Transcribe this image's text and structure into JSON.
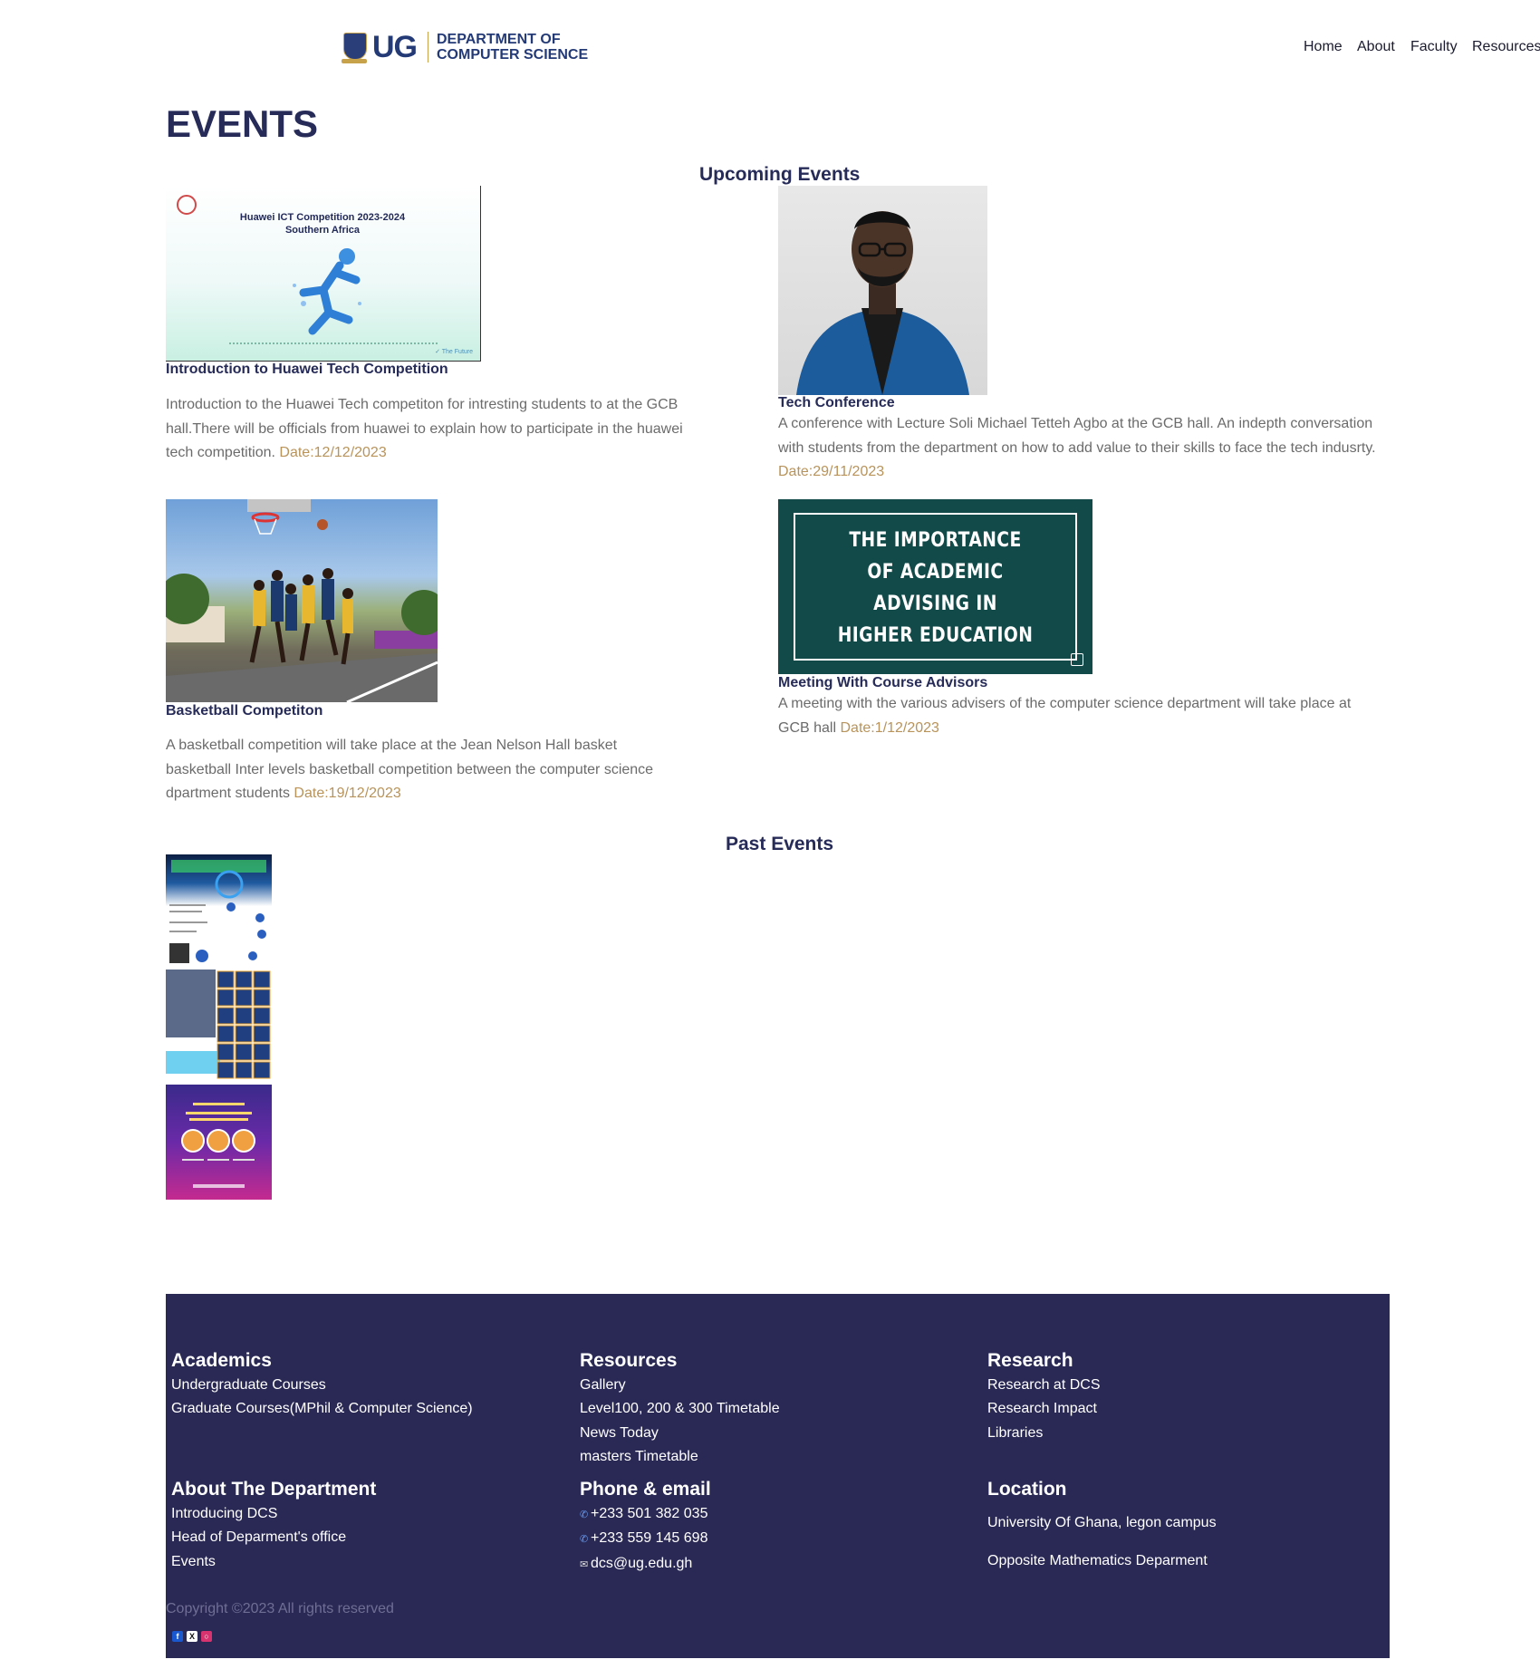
{
  "header": {
    "logo_mark": "UG",
    "logo_line1": "DEPARTMENT OF",
    "logo_line2": "COMPUTER SCIENCE",
    "nav": [
      "Home",
      "About",
      "Faculty",
      "Resources"
    ]
  },
  "page_title": "EVENTS",
  "upcoming": {
    "heading": "Upcoming Events",
    "events": [
      {
        "title": "Introduction to Huawei Tech Competition",
        "image_caption_line1": "Huawei ICT Competition 2023-2024",
        "image_caption_line2": "Southern Africa",
        "image_tag": "✓ The Future",
        "description": "Introduction to the Huawei Tech competiton for intresting students to at the GCB hall.There will be officials from huawei to explain how to participate in the huawei tech competition.",
        "date": "Date:12/12/2023"
      },
      {
        "title": "Tech Conference",
        "description": "A conference with Lecture Soli Michael Tetteh Agbo at the GCB hall. An indepth conversation with students from the department on how to add value to their skills to face the tech indusrty.",
        "date": "Date:29/11/2023"
      },
      {
        "title": "Basketball Competiton",
        "description": "A basketball competition will take place at the Jean Nelson Hall basket basketball Inter levels basketball competition between the computer science dpartment students",
        "date": "Date:19/12/2023"
      },
      {
        "title": "Meeting With Course Advisors",
        "image_text": [
          "THE IMPORTANCE",
          "OF ACADEMIC",
          "ADVISING IN",
          "HIGHER EDUCATION"
        ],
        "description": "A meeting with the various advisers of the computer science department will take place at GCB hall",
        "date": "Date:1/12/2023"
      }
    ]
  },
  "past": {
    "heading": "Past Events"
  },
  "footer": {
    "academics": {
      "heading": "Academics",
      "items": [
        "Undergraduate Courses",
        "Graduate Courses(MPhil & Computer Science)"
      ]
    },
    "resources": {
      "heading": "Resources",
      "items": [
        "Gallery",
        "Level100, 200 & 300 Timetable",
        "News Today",
        "masters Timetable"
      ]
    },
    "research": {
      "heading": "Research",
      "items": [
        "Research at DCS",
        "Research Impact",
        "Libraries"
      ]
    },
    "about": {
      "heading": "About The Department",
      "items": [
        "Introducing DCS",
        "Head of Deparment's office",
        "Events"
      ]
    },
    "contact": {
      "heading": "Phone & email",
      "phone1": "+233 501 382 035",
      "phone2": "+233 559 145 698",
      "email": "dcs@ug.edu.gh"
    },
    "location": {
      "heading": "Location",
      "line1": "University Of Ghana, legon campus",
      "line2": "Opposite Mathematics Deparment"
    },
    "copyright": "Copyright ©2023 All rights reserved",
    "social_icons": [
      "facebook-icon",
      "x-icon",
      "instagram-icon"
    ]
  },
  "colors": {
    "primary_navy": "#262b58",
    "footer_bg": "#2a2955",
    "date_accent": "#b8935a",
    "body_text": "#6b6b6b"
  }
}
